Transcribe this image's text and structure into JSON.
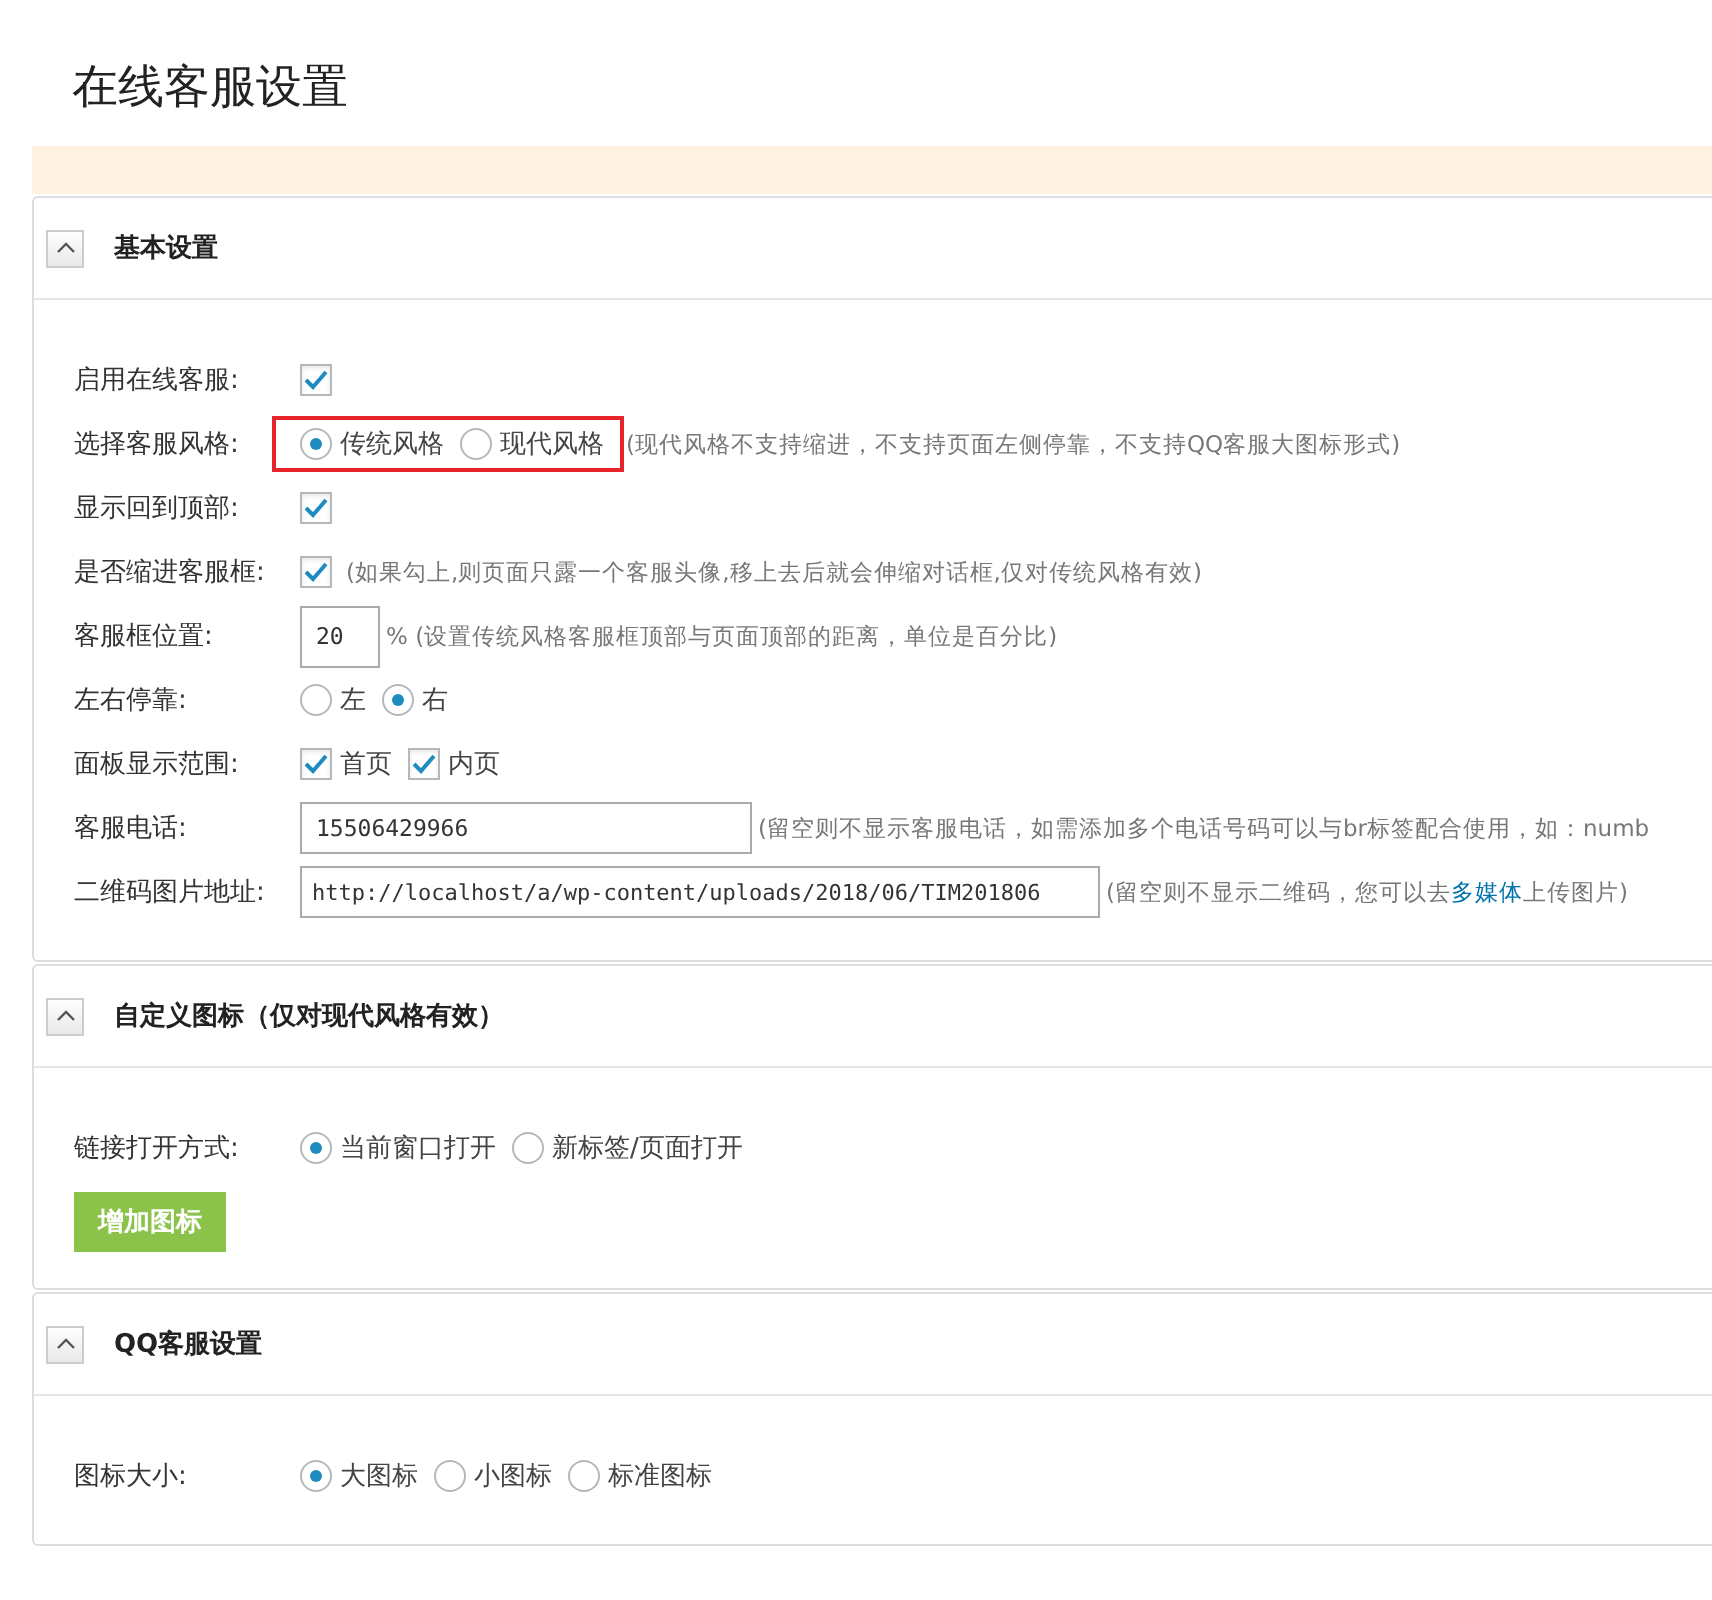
{
  "page_title": "在线客服设置",
  "notice": {
    "kind": "warning"
  },
  "panels": [
    {
      "title": "基本设置",
      "expanded": true,
      "rows": [
        {
          "label": "启用在线客服:",
          "controls": [
            {
              "kind": "checkbox",
              "checked": true
            }
          ]
        },
        {
          "label": "选择客服风格:",
          "highlighted": true,
          "controls": [
            {
              "kind": "radio",
              "selected": true,
              "label": "传统风格"
            },
            {
              "kind": "radio",
              "selected": false,
              "label": "现代风格"
            }
          ],
          "note": [
            {
              "text": "(现代风格不支持缩进，不支持页面左侧停靠，不支持QQ客服大图标形式)"
            }
          ]
        },
        {
          "label": "显示回到顶部:",
          "controls": [
            {
              "kind": "checkbox",
              "checked": true
            }
          ]
        },
        {
          "label": "是否缩进客服框:",
          "controls": [
            {
              "kind": "checkbox",
              "checked": true
            }
          ],
          "note": [
            {
              "text": "(如果勾上,则页面只露一个客服头像,移上去后就会伸缩对话框,仅对传统风格有效)"
            }
          ]
        },
        {
          "label": "客服框位置:",
          "controls": [
            {
              "kind": "number",
              "value": "20"
            }
          ],
          "note": [
            {
              "text": "% (设置传统风格客服框顶部与页面顶部的距离，单位是百分比)"
            }
          ]
        },
        {
          "label": "左右停靠:",
          "controls": [
            {
              "kind": "radio",
              "selected": false,
              "label": "左"
            },
            {
              "kind": "radio",
              "selected": true,
              "label": "右"
            }
          ]
        },
        {
          "label": "面板显示范围:",
          "controls": [
            {
              "kind": "checkbox",
              "checked": true,
              "label": "首页"
            },
            {
              "kind": "checkbox",
              "checked": true,
              "label": "内页"
            }
          ]
        },
        {
          "label": "客服电话:",
          "controls": [
            {
              "kind": "input",
              "value": "15506429966"
            }
          ],
          "note": [
            {
              "text": "(留空则不显示客服电话，如需添加多个电话号码可以与br标签配合使用，如：numb"
            }
          ]
        },
        {
          "label": "二维码图片地址:",
          "controls": [
            {
              "kind": "wide_input",
              "value": "http://localhost/a/wp-content/uploads/2018/06/TIM201806"
            }
          ],
          "note": [
            {
              "text": "(留空则不显示二维码，您可以去"
            },
            {
              "text": "多媒体",
              "link": true
            },
            {
              "text": "上传图片)"
            }
          ]
        }
      ]
    },
    {
      "title": "自定义图标（仅对现代风格有效）",
      "expanded": true,
      "rows": [
        {
          "label": "链接打开方式:",
          "controls": [
            {
              "kind": "radio",
              "selected": true,
              "label": "当前窗口打开"
            },
            {
              "kind": "radio",
              "selected": false,
              "label": "新标签/页面打开"
            }
          ]
        }
      ],
      "button": "增加图标"
    },
    {
      "title": "QQ客服设置",
      "expanded": true,
      "rows": [
        {
          "label": "图标大小:",
          "controls": [
            {
              "kind": "radio",
              "selected": true,
              "label": "大图标"
            },
            {
              "kind": "radio",
              "selected": false,
              "label": "小图标"
            },
            {
              "kind": "radio",
              "selected": false,
              "label": "标准图标"
            }
          ]
        }
      ]
    }
  ]
}
